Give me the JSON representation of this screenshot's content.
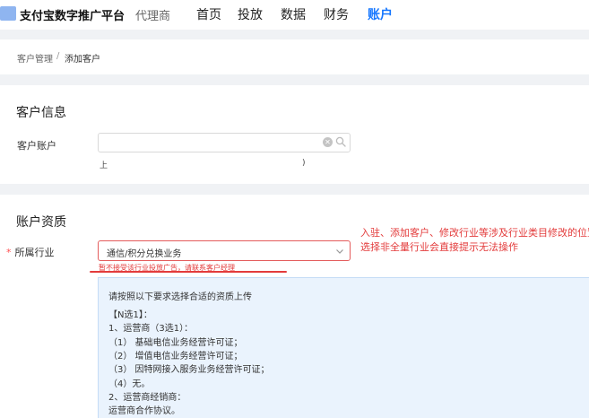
{
  "header": {
    "brand": "支付宝数字推广平台",
    "agent_label": "代理商",
    "nav": [
      "首页",
      "投放",
      "数据",
      "财务",
      "账户"
    ],
    "active_index": 4
  },
  "breadcrumb": {
    "parent": "客户管理",
    "separator": "/",
    "current": "添加客户"
  },
  "customer_info": {
    "title": "客户信息",
    "account_label": "客户账户",
    "account_value": "",
    "faint_left": "上",
    "faint_right": ")"
  },
  "qualification": {
    "title": "账户资质",
    "industry_label": "所属行业",
    "industry_value": "通信/积分兑换业务",
    "error": "暂不接受该行业投放广告，请联系客户经理",
    "annotation_line1": "入驻、添加客户、修改行业等涉及行业类目修改的位置",
    "annotation_line2": "选择非全量行业会直接提示无法操作",
    "info": {
      "intro": "请按照以下要求选择合适的资质上传",
      "n_choose": "【N选1】：",
      "item1": "1、运营商（3选1）：",
      "sub1": "（1） 基础电信业务经营许可证；",
      "sub2": "（2） 增值电信业务经营许可证；",
      "sub3": "（3） 因特网接入服务业务经营许可证；",
      "sub4": "（4）无。",
      "item2": "2、运营商经销商：",
      "item2_desc": "运营商合作协议。"
    }
  },
  "colors": {
    "accent": "#1677ff",
    "error": "#e33b3b",
    "info_bg": "#eaf3fd"
  }
}
